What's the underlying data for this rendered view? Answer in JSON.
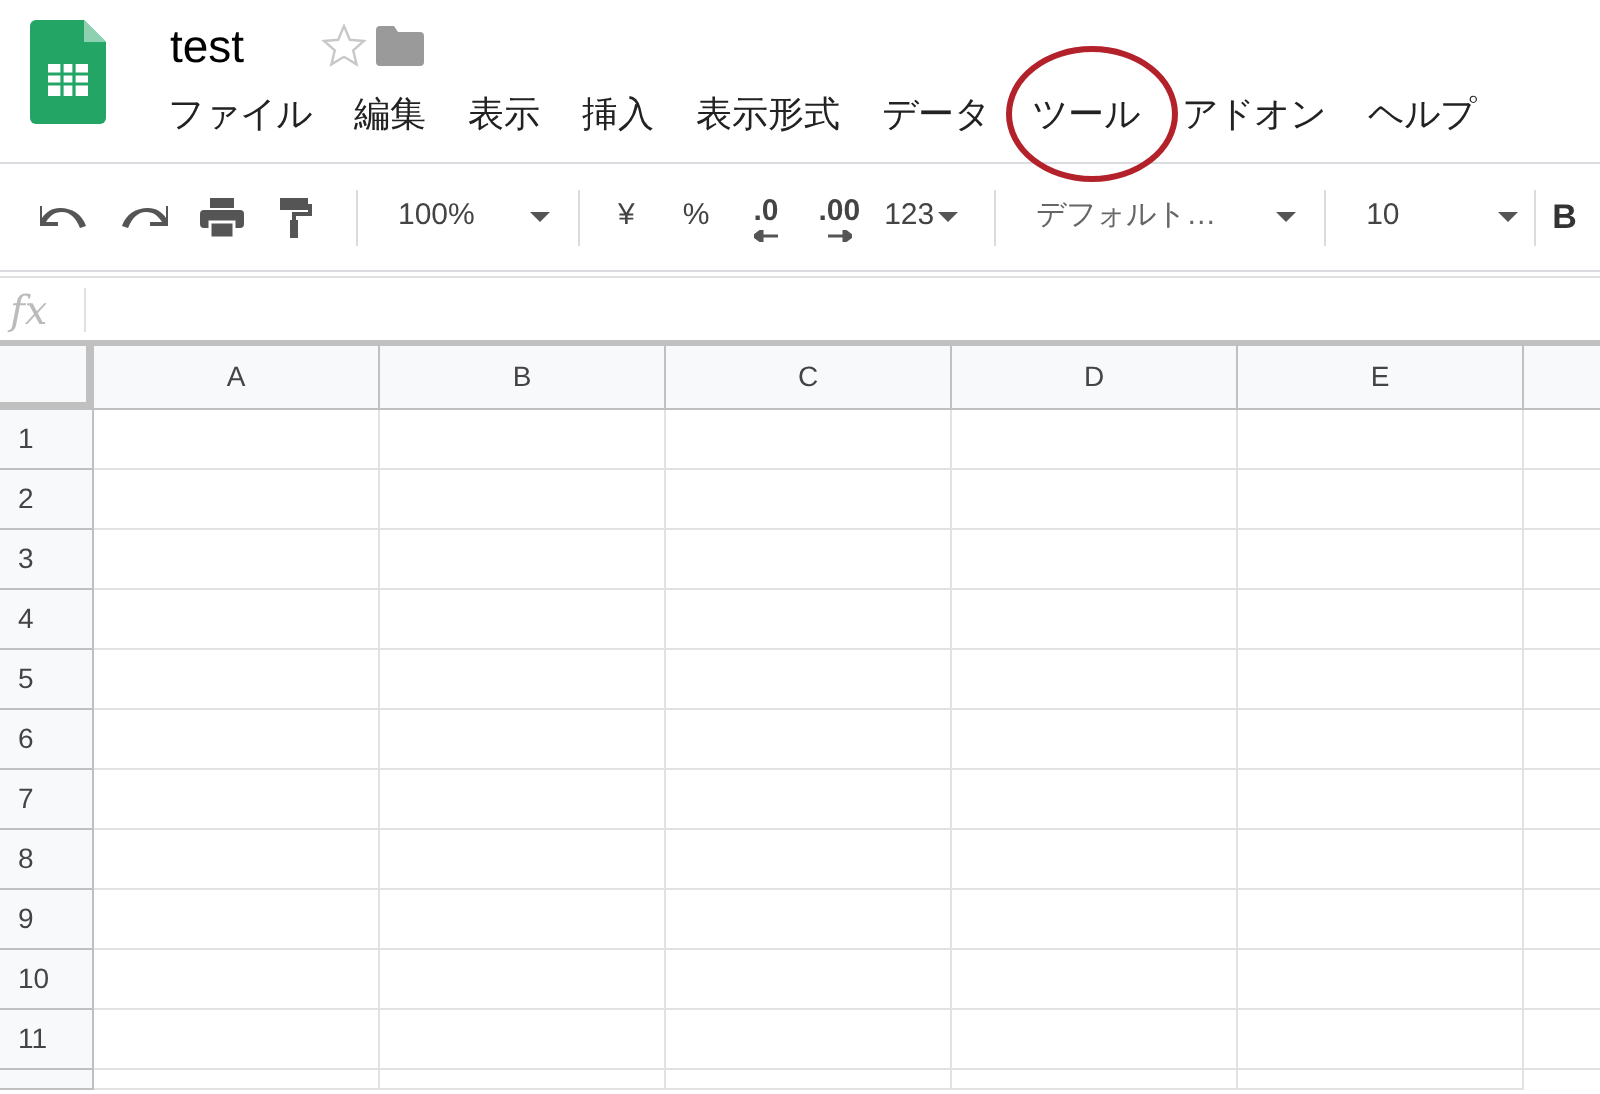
{
  "document": {
    "title": "test",
    "starred": false
  },
  "menu": [
    {
      "label": "ファイル",
      "circled": false
    },
    {
      "label": "編集",
      "circled": false
    },
    {
      "label": "表示",
      "circled": false
    },
    {
      "label": "挿入",
      "circled": false
    },
    {
      "label": "表示形式",
      "circled": false
    },
    {
      "label": "データ",
      "circled": false
    },
    {
      "label": "ツール",
      "circled": true
    },
    {
      "label": "アドオン",
      "circled": false
    },
    {
      "label": "ヘルプ",
      "circled": false
    }
  ],
  "toolbar": {
    "zoom": "100%",
    "currency": "¥",
    "percent": "%",
    "decrease_decimals": ".0",
    "increase_decimals": ".00",
    "number_format": "123",
    "font": "デフォルト…",
    "font_size": "10",
    "bold": "B"
  },
  "formula_bar": {
    "label": "fx"
  },
  "sheet": {
    "columns": [
      "A",
      "B",
      "C",
      "D",
      "E"
    ],
    "rows": [
      "1",
      "2",
      "3",
      "4",
      "5",
      "6",
      "7",
      "8",
      "9",
      "10",
      "11"
    ]
  }
}
